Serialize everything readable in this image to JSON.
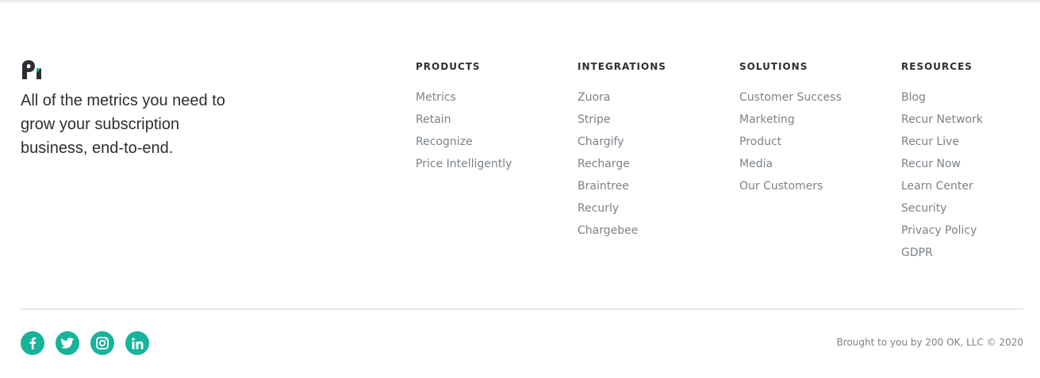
{
  "brand": {
    "logo_icon": "profitwell-logo-icon",
    "tagline": "All of the metrics you need to grow your subscription business, end-to-end."
  },
  "columns": [
    {
      "heading": "PRODUCTS",
      "links": [
        "Metrics",
        "Retain",
        "Recognize",
        "Price Intelligently"
      ]
    },
    {
      "heading": "INTEGRATIONS",
      "links": [
        "Zuora",
        "Stripe",
        "Chargify",
        "Recharge",
        "Braintree",
        "Recurly",
        "Chargebee"
      ]
    },
    {
      "heading": "SOLUTIONS",
      "links": [
        "Customer Success",
        "Marketing",
        "Product",
        "Media",
        "Our Customers"
      ]
    },
    {
      "heading": "RESOURCES",
      "links": [
        "Blog",
        "Recur Network",
        "Recur Live",
        "Recur Now",
        "Learn Center",
        "Security",
        "Privacy Policy",
        "GDPR"
      ]
    }
  ],
  "social": [
    {
      "name": "facebook-icon"
    },
    {
      "name": "twitter-icon"
    },
    {
      "name": "instagram-icon"
    },
    {
      "name": "linkedin-icon"
    }
  ],
  "footer": {
    "copyright": "Brought to you by 200 OK, LLC © 2020"
  },
  "colors": {
    "accent": "#17b39b",
    "heading": "#2b2f33",
    "link": "#7b8288",
    "rule": "#e6e7e8"
  }
}
